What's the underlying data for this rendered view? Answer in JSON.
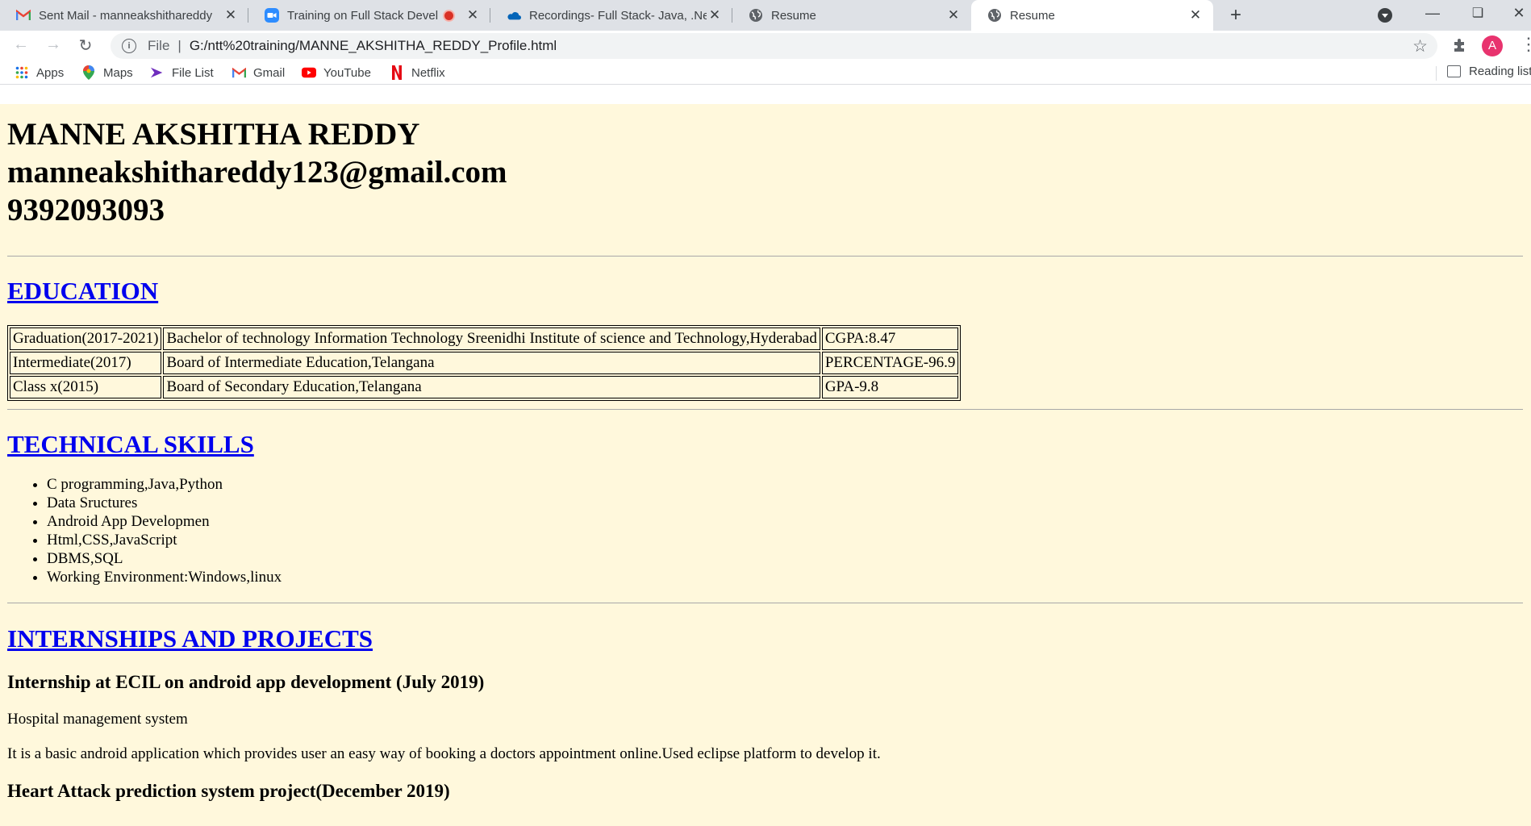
{
  "browser": {
    "tabs": [
      {
        "title": "Sent Mail - manneakshithareddy",
        "icon": "gmail-icon"
      },
      {
        "title": "Training on Full Stack Develo",
        "icon": "zoom-icon",
        "recording": true
      },
      {
        "title": "Recordings- Full Stack- Java, .Net",
        "icon": "onedrive-icon"
      },
      {
        "title": "Resume",
        "icon": "globe-icon"
      },
      {
        "title": "Resume",
        "icon": "globe-icon",
        "active": true
      }
    ],
    "address": {
      "scheme": "File",
      "url": "G:/ntt%20training/MANNE_AKSHITHA_REDDY_Profile.html"
    },
    "profile_initial": "A",
    "bookmarks": [
      {
        "label": "Apps",
        "icon": "apps-grid-icon"
      },
      {
        "label": "Maps",
        "icon": "maps-pin-icon"
      },
      {
        "label": "File List",
        "icon": "file-list-icon"
      },
      {
        "label": "Gmail",
        "icon": "gmail-icon"
      },
      {
        "label": "YouTube",
        "icon": "youtube-icon"
      },
      {
        "label": "Netflix",
        "icon": "netflix-icon"
      }
    ],
    "reading_list": "Reading list"
  },
  "resume": {
    "name": "MANNE AKSHITHA REDDY",
    "email": "manneakshithareddy123@gmail.com",
    "phone": "9392093093",
    "education": {
      "heading": "EDUCATION",
      "rows": [
        [
          "Graduation(2017-2021)",
          "Bachelor of technology Information Technology Sreenidhi Institute of science and Technology,Hyderabad",
          "CGPA:8.47"
        ],
        [
          "Intermediate(2017)",
          "Board of Intermediate Education,Telangana",
          "PERCENTAGE-96.9"
        ],
        [
          "Class x(2015)",
          "Board of Secondary Education,Telangana",
          "GPA-9.8"
        ]
      ]
    },
    "skills": {
      "heading": "TECHNICAL SKILLS",
      "items": [
        "C programming,Java,Python",
        "Data Sructures",
        "Android App Developmen",
        "Html,CSS,JavaScript",
        "DBMS,SQL",
        "Working Environment:Windows,linux"
      ]
    },
    "projects": {
      "heading": "INTERNSHIPS AND PROJECTS",
      "internship_title": "Internship at ECIL on android app development (July 2019)",
      "internship_project": "Hospital management system",
      "internship_desc": "It is a basic android application which provides user an easy way of booking a doctors appointment online.Used eclipse platform to develop it.",
      "project2_title": "Heart Attack prediction system project(December 2019)"
    }
  },
  "colors": {
    "page_bg": "#fff8dc",
    "link": "#0000ee",
    "tabstrip": "#dee1e6"
  }
}
